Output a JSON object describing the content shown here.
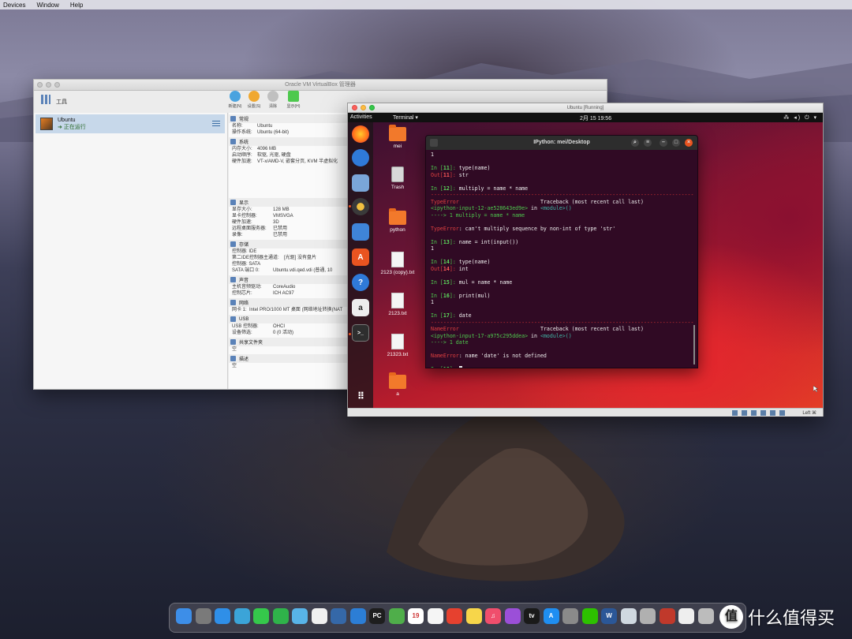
{
  "mac_menubar": {
    "items": [
      "Devices",
      "Window",
      "Help"
    ]
  },
  "vbox": {
    "title": "Oracle VM VirtualBox 管理器",
    "tools_label": "工具",
    "toolbar": [
      {
        "label": "新建(N)",
        "color": "#4aa3df"
      },
      {
        "label": "设置(S)",
        "color": "#f0a830"
      },
      {
        "label": "清除",
        "color": "#c0c0c0"
      },
      {
        "label": "显示(H)",
        "color": "#4ec94e"
      }
    ],
    "vm": {
      "name": "Ubuntu",
      "state": "正在运行"
    },
    "details": {
      "general": {
        "header": "常规",
        "rows": [
          {
            "k": "名称:",
            "v": "Ubuntu"
          },
          {
            "k": "操作系统:",
            "v": "Ubuntu (64-bit)"
          }
        ]
      },
      "system": {
        "header": "系统",
        "rows": [
          {
            "k": "内存大小:",
            "v": "4096 MB"
          },
          {
            "k": "启动顺序:",
            "v": "软驱, 光驱, 硬盘"
          },
          {
            "k": "硬件加速:",
            "v": "VT-x/AMD-V, 嵌套分页, KVM 半虚拟化"
          }
        ]
      },
      "display": {
        "header": "显示",
        "rows": [
          {
            "k": "显存大小:",
            "v": "128 MB"
          },
          {
            "k": "显卡控制器:",
            "v": "VMSVGA"
          },
          {
            "k": "硬件加速:",
            "v": "3D"
          },
          {
            "k": "远程桌面服务器:",
            "v": "已禁用"
          },
          {
            "k": "录像:",
            "v": "已禁用"
          }
        ]
      },
      "storage": {
        "header": "存储",
        "rows": [
          {
            "k": "控制器: IDE",
            "v": ""
          },
          {
            "k": "  第二IDE控制器主通道:",
            "v": "[光驱] 没有盘片"
          },
          {
            "k": "控制器: SATA",
            "v": ""
          },
          {
            "k": "  SATA 端口 0:",
            "v": "Ubuntu.vdi.qed.vdi (普通, 10"
          }
        ]
      },
      "audio": {
        "header": "声音",
        "rows": [
          {
            "k": "主机音频驱动:",
            "v": "CoreAudio"
          },
          {
            "k": "控制芯片:",
            "v": "ICH AC97"
          }
        ]
      },
      "network": {
        "header": "网络",
        "rows": [
          {
            "k": "网卡 1:",
            "v": "Intel PRO/1000 MT 桌面 (网络地址转换(NAT"
          }
        ]
      },
      "usb": {
        "header": "USB",
        "rows": [
          {
            "k": "USB 控制器:",
            "v": "OHCI"
          },
          {
            "k": "设备筛选:",
            "v": "0 (0 活动)"
          }
        ]
      },
      "shared": {
        "header": "共享文件夹",
        "rows": [
          {
            "k": "空",
            "v": ""
          }
        ]
      },
      "description": {
        "header": "描述",
        "rows": [
          {
            "k": "空",
            "v": ""
          }
        ]
      }
    }
  },
  "ubuntu_window": {
    "title": "Ubuntu [Running]",
    "topbar": {
      "activities": "Activities",
      "app": "Terminal ▾",
      "clock": "2月 15  19:56",
      "tray": "⁂ ◂) ⏻ ▾"
    },
    "desktop_icons": [
      {
        "label": "mei",
        "type": "folder"
      },
      {
        "label": "Trash",
        "type": "trash"
      },
      {
        "label": "python",
        "type": "folder"
      },
      {
        "label": "2123 (copy).txt",
        "type": "doc"
      },
      {
        "label": "2123.txt",
        "type": "doc"
      },
      {
        "label": "21323.txt",
        "type": "doc"
      },
      {
        "label": "a",
        "type": "folder"
      }
    ],
    "status_right": "Left ⌘",
    "accent": "#e95420"
  },
  "terminal": {
    "title": "IPython: mei/Desktop",
    "lines": [
      {
        "t": "plain",
        "text": "1"
      },
      {
        "t": "blank"
      },
      {
        "t": "in",
        "n": "11",
        "code": "type(name)"
      },
      {
        "t": "out",
        "n": "11",
        "text": "str"
      },
      {
        "t": "blank"
      },
      {
        "t": "in",
        "n": "12",
        "code": "multiply = name * name"
      },
      {
        "t": "dash"
      },
      {
        "t": "errhead",
        "name": "TypeError",
        "tb": "Traceback (most recent call last)"
      },
      {
        "t": "mod",
        "text": "<ipython-input-12-ae528643ed9e>",
        "tail": " in ",
        "mod": "<module>()"
      },
      {
        "t": "arrow",
        "text": "----> 1 multiply = name * name"
      },
      {
        "t": "blank"
      },
      {
        "t": "errmsg",
        "name": "TypeError",
        "text": ": can't multiply sequence by non-int of type 'str'"
      },
      {
        "t": "blank"
      },
      {
        "t": "in",
        "n": "13",
        "code": "name = int(input())"
      },
      {
        "t": "plain",
        "text": "1"
      },
      {
        "t": "blank"
      },
      {
        "t": "in",
        "n": "14",
        "code": "type(name)"
      },
      {
        "t": "out",
        "n": "14",
        "text": "int"
      },
      {
        "t": "blank"
      },
      {
        "t": "in",
        "n": "15",
        "code": "mul = name * name"
      },
      {
        "t": "blank"
      },
      {
        "t": "in",
        "n": "16",
        "code": "print(mul)"
      },
      {
        "t": "plain",
        "text": "1"
      },
      {
        "t": "blank"
      },
      {
        "t": "in",
        "n": "17",
        "code": "date"
      },
      {
        "t": "dash"
      },
      {
        "t": "errhead",
        "name": "NameError",
        "tb": "Traceback (most recent call last)"
      },
      {
        "t": "mod",
        "text": "<ipython-input-17-a975c295ddea>",
        "tail": " in ",
        "mod": "<module>()"
      },
      {
        "t": "arrow",
        "text": "----> 1 date"
      },
      {
        "t": "blank"
      },
      {
        "t": "errmsg",
        "name": "NameError",
        "text": ": name 'date' is not defined"
      },
      {
        "t": "blank"
      },
      {
        "t": "prompt",
        "n": "18"
      }
    ]
  },
  "mac_dock": {
    "apps": [
      {
        "name": "finder",
        "color": "#3d8ee8",
        "glyph": ""
      },
      {
        "name": "launchpad",
        "color": "#7a7a7a",
        "glyph": ""
      },
      {
        "name": "safari",
        "color": "#2f8fe8",
        "glyph": ""
      },
      {
        "name": "photos",
        "color": "#3ba4d8",
        "glyph": ""
      },
      {
        "name": "messages",
        "color": "#35c84b",
        "glyph": ""
      },
      {
        "name": "facetime",
        "color": "#2fb34a",
        "glyph": ""
      },
      {
        "name": "maps",
        "color": "#58b4e8",
        "glyph": ""
      },
      {
        "name": "photos-app",
        "color": "#f0f0f0",
        "glyph": ""
      },
      {
        "name": "virtualbox",
        "color": "#3568a8",
        "glyph": ""
      },
      {
        "name": "vscode",
        "color": "#2c7ed6",
        "glyph": ""
      },
      {
        "name": "pycharm",
        "color": "#1e1e1e",
        "glyph": "PC"
      },
      {
        "name": "growl",
        "color": "#4fae4a",
        "glyph": ""
      },
      {
        "name": "calendar",
        "color": "#ffffff",
        "glyph": "19"
      },
      {
        "name": "reminders",
        "color": "#f5f5f5",
        "glyph": ""
      },
      {
        "name": "chrome",
        "color": "#e6412f",
        "glyph": ""
      },
      {
        "name": "notes",
        "color": "#f7d64a",
        "glyph": ""
      },
      {
        "name": "music",
        "color": "#f04e6c",
        "glyph": "♫"
      },
      {
        "name": "podcasts",
        "color": "#9b4fd8",
        "glyph": ""
      },
      {
        "name": "tv",
        "color": "#1a1a1a",
        "glyph": "tv"
      },
      {
        "name": "app-store",
        "color": "#1f8ef1",
        "glyph": "A"
      },
      {
        "name": "system-preferences",
        "color": "#8a8a8a",
        "glyph": ""
      },
      {
        "name": "wechat",
        "color": "#2dc100",
        "glyph": ""
      },
      {
        "name": "word",
        "color": "#2b5797",
        "glyph": "W"
      },
      {
        "name": "preview",
        "color": "#cfd8e0",
        "glyph": ""
      },
      {
        "name": "dvd-player",
        "color": "#b0b0b0",
        "glyph": ""
      },
      {
        "name": "photo-booth",
        "color": "#c0392b",
        "glyph": ""
      },
      {
        "name": "documents",
        "color": "#eeeeee",
        "glyph": ""
      },
      {
        "name": "trash",
        "color": "#bcbcbc",
        "glyph": ""
      }
    ]
  },
  "watermark": {
    "text": "什么值得买",
    "logo": "值"
  }
}
